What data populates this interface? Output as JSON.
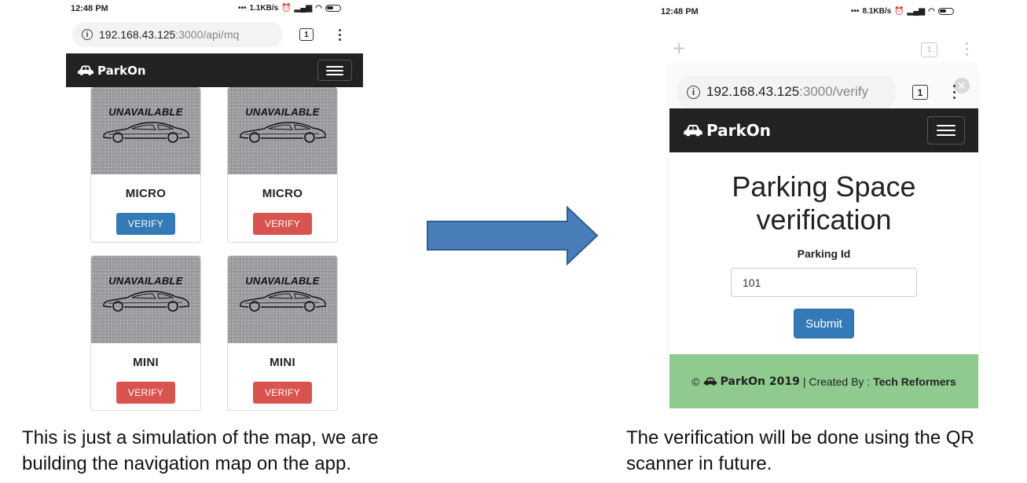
{
  "left_phone": {
    "status": {
      "time": "12:48 PM",
      "speed": "1.1KB/s"
    },
    "url": {
      "host": "192.168.43.125",
      "path": ":3000/api/mq"
    },
    "tab_count": "1",
    "brand": "ParkOn",
    "cards": [
      {
        "overlay": "UNAVAILABLE",
        "title": "MICRO",
        "button": "VERIFY",
        "button_color": "#337ab7"
      },
      {
        "overlay": "UNAVAILABLE",
        "title": "MICRO",
        "button": "VERIFY",
        "button_color": "#d9534f"
      },
      {
        "overlay": "UNAVAILABLE",
        "title": "MINI",
        "button": "VERIFY",
        "button_color": "#d9534f"
      },
      {
        "overlay": "UNAVAILABLE",
        "title": "MINI",
        "button": "VERIFY",
        "button_color": "#d9534f"
      }
    ]
  },
  "right_phone": {
    "status": {
      "time": "12:48 PM",
      "speed": "8.1KB/s"
    },
    "tab_count": "1",
    "url": {
      "host": "192.168.43.125",
      "path": ":3000/verify"
    },
    "brand": "ParkOn",
    "page_title_line1": "Parking Space",
    "page_title_line2": "verification",
    "field_label": "Parking Id",
    "field_value": "101",
    "submit_label": "Submit",
    "footer": {
      "copyright": "©",
      "brand": "ParkOn 2019",
      "separator": "| Created By :",
      "team": "Tech Reformers"
    }
  },
  "arrow_color": "#4a7ebb",
  "captions": {
    "left_line1": "This is just a simulation of the map, we are",
    "left_line2": "building the navigation map on the app.",
    "right_line1": "The verification will be done using the QR",
    "right_line2": "scanner in future."
  }
}
